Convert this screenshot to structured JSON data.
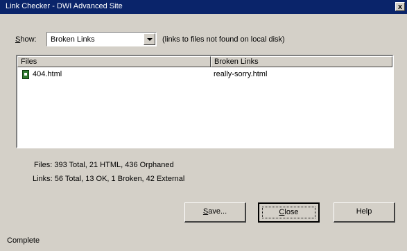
{
  "window": {
    "title": "Link Checker - DWI Advanced Site",
    "close_glyph": "x"
  },
  "filter": {
    "label_accel": "S",
    "label_rest": "how:",
    "selected": "Broken Links",
    "hint": "(links to files not found on local disk)"
  },
  "list": {
    "columns": [
      "Files",
      "Broken Links"
    ],
    "rows": [
      {
        "file": "404.html",
        "broken_link": "really-sorry.html"
      }
    ]
  },
  "stats": {
    "files": "Files: 393 Total, 21 HTML, 436 Orphaned",
    "links": "Links: 56 Total, 13 OK, 1 Broken, 42 External"
  },
  "buttons": {
    "save_accel": "S",
    "save_rest": "ave...",
    "close_accel": "C",
    "close_rest": "lose",
    "help": "Help"
  },
  "status": "Complete"
}
